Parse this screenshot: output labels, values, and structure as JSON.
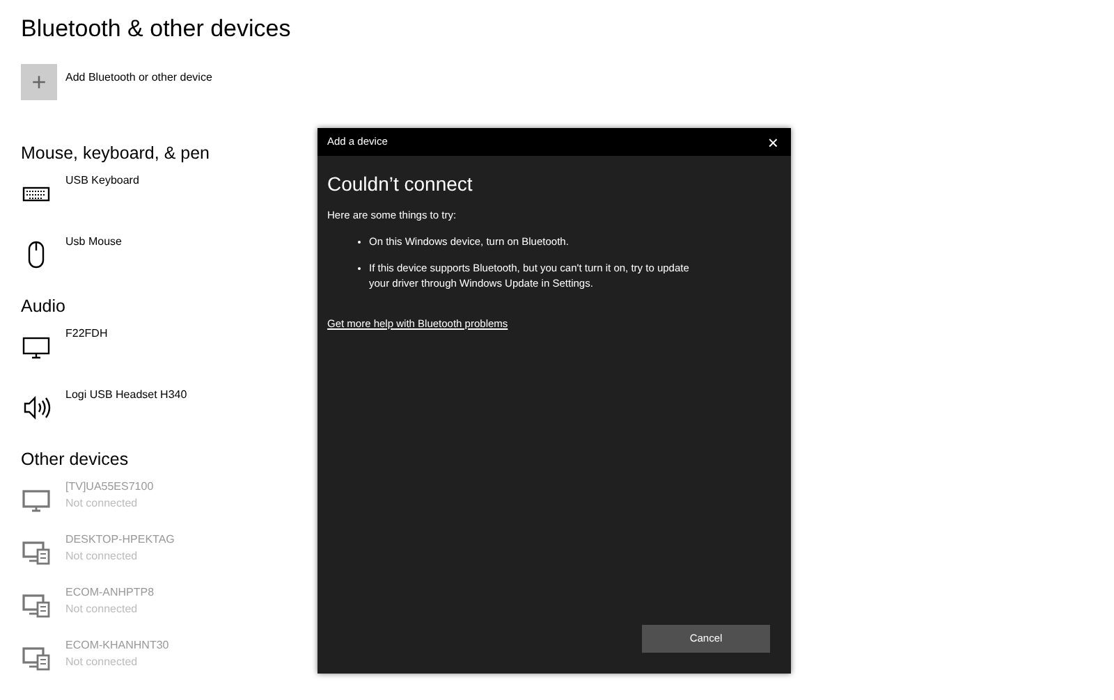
{
  "page": {
    "title": "Bluetooth & other devices",
    "add_button": {
      "icon": "+",
      "label": "Add Bluetooth or other device"
    }
  },
  "sections": [
    {
      "heading": "Mouse, keyboard, & pen",
      "devices": [
        {
          "kind": "keyboard",
          "name": "USB Keyboard"
        },
        {
          "kind": "mouse",
          "name": "Usb Mouse"
        }
      ]
    },
    {
      "heading": "Audio",
      "devices": [
        {
          "kind": "monitor",
          "name": "F22FDH"
        },
        {
          "kind": "speaker",
          "name": "Logi USB Headset H340"
        }
      ]
    },
    {
      "heading": "Other devices",
      "devices": [
        {
          "kind": "tv",
          "name": "[TV]UA55ES7100",
          "status": "Not connected"
        },
        {
          "kind": "computer",
          "name": "DESKTOP-HPEKTAG",
          "status": "Not connected"
        },
        {
          "kind": "computer",
          "name": "ECOM-ANHPTP8",
          "status": "Not connected"
        },
        {
          "kind": "computer",
          "name": "ECOM-KHANHNT30",
          "status": "Not connected"
        }
      ]
    }
  ],
  "dialog": {
    "title": "Add a device",
    "close": "×",
    "heading": "Couldn’t connect",
    "intro": "Here are some things to try:",
    "bullets": [
      "On this Windows device, turn on Bluetooth.",
      "If this device supports Bluetooth, but you can't turn it on, try to update your driver through Windows Update in Settings."
    ],
    "link": "Get more help with Bluetooth problems",
    "button": "Cancel"
  }
}
